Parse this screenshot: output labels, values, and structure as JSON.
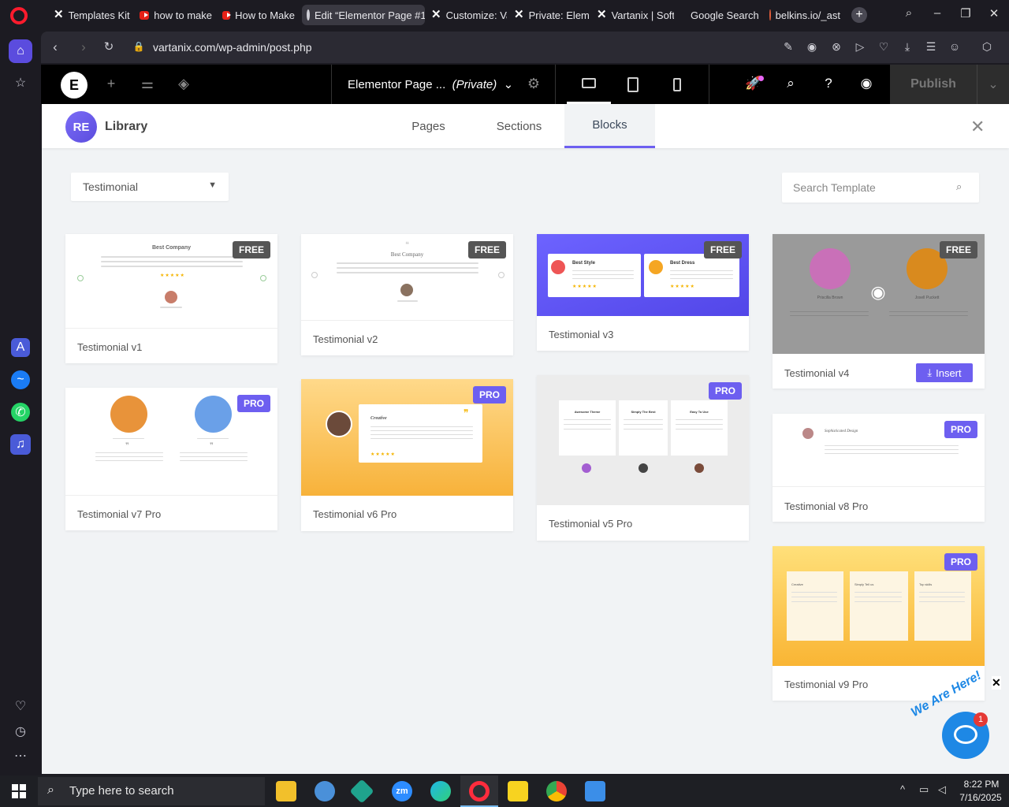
{
  "browser": {
    "tabs": [
      {
        "title": "Templates Kit",
        "icon": "x-icon"
      },
      {
        "title": "how to make",
        "icon": "youtube-icon"
      },
      {
        "title": "How to Make",
        "icon": "youtube-icon"
      },
      {
        "title": "Edit “Elementor Page #1",
        "icon": "globe-icon",
        "active": true
      },
      {
        "title": "Customize: Va",
        "icon": "x-icon"
      },
      {
        "title": "Private: Eleme",
        "icon": "x-icon"
      },
      {
        "title": "Vartanix | Soft",
        "icon": "x-icon"
      },
      {
        "title": "Google Search",
        "icon": "google-icon"
      },
      {
        "title": "belkins.io/_ast",
        "icon": "belkins-icon"
      }
    ],
    "url": "vartanix.com/wp-admin/post.php"
  },
  "elementor": {
    "page_title": "Elementor Page ...",
    "page_status": "(Private)",
    "publish_label": "Publish"
  },
  "library": {
    "title": "Library",
    "logo_text": "RE",
    "tabs": [
      "Pages",
      "Sections",
      "Blocks"
    ],
    "active_tab": "Blocks",
    "filter_value": "Testimonial",
    "search_placeholder": "Search Template",
    "insert_label": "Insert",
    "cards": [
      {
        "title": "Testimonial v1",
        "badge": "FREE"
      },
      {
        "title": "Testimonial v2",
        "badge": "FREE"
      },
      {
        "title": "Testimonial v3",
        "badge": "FREE"
      },
      {
        "title": "Testimonial v4",
        "badge": "FREE"
      },
      {
        "title": "Testimonial v7 Pro",
        "badge": "PRO"
      },
      {
        "title": "Testimonial v6 Pro",
        "badge": "PRO"
      },
      {
        "title": "Testimonial v5 Pro",
        "badge": "PRO"
      },
      {
        "title": "Testimonial v8 Pro",
        "badge": "PRO"
      },
      {
        "title": "Testimonial v9 Pro",
        "badge": "PRO"
      }
    ],
    "thumb_text": {
      "v1": "Best Company",
      "v2": "Best Company",
      "v3a": "Best Style",
      "v3b": "Best Dress",
      "v4a": "Priscilla Brown",
      "v4b": "Josell Puckett",
      "v6": "Creative",
      "v5a": "Awesome Theme",
      "v5b": "Simply The Best",
      "v5c": "Easy To Use",
      "v8": "Sophisticated Design",
      "v9a": "Creative",
      "v9b": "Simply Tell us",
      "v9c": "Top skills"
    }
  },
  "chat": {
    "badge_count": "1",
    "tagline": "We Are Here!"
  },
  "taskbar": {
    "search_placeholder": "Type here to search",
    "time": "8:22 PM",
    "date": "7/16/2025"
  },
  "colors": {
    "accent": "#6d5ff0",
    "badge_free": "#555555",
    "chat": "#1e88e5"
  }
}
